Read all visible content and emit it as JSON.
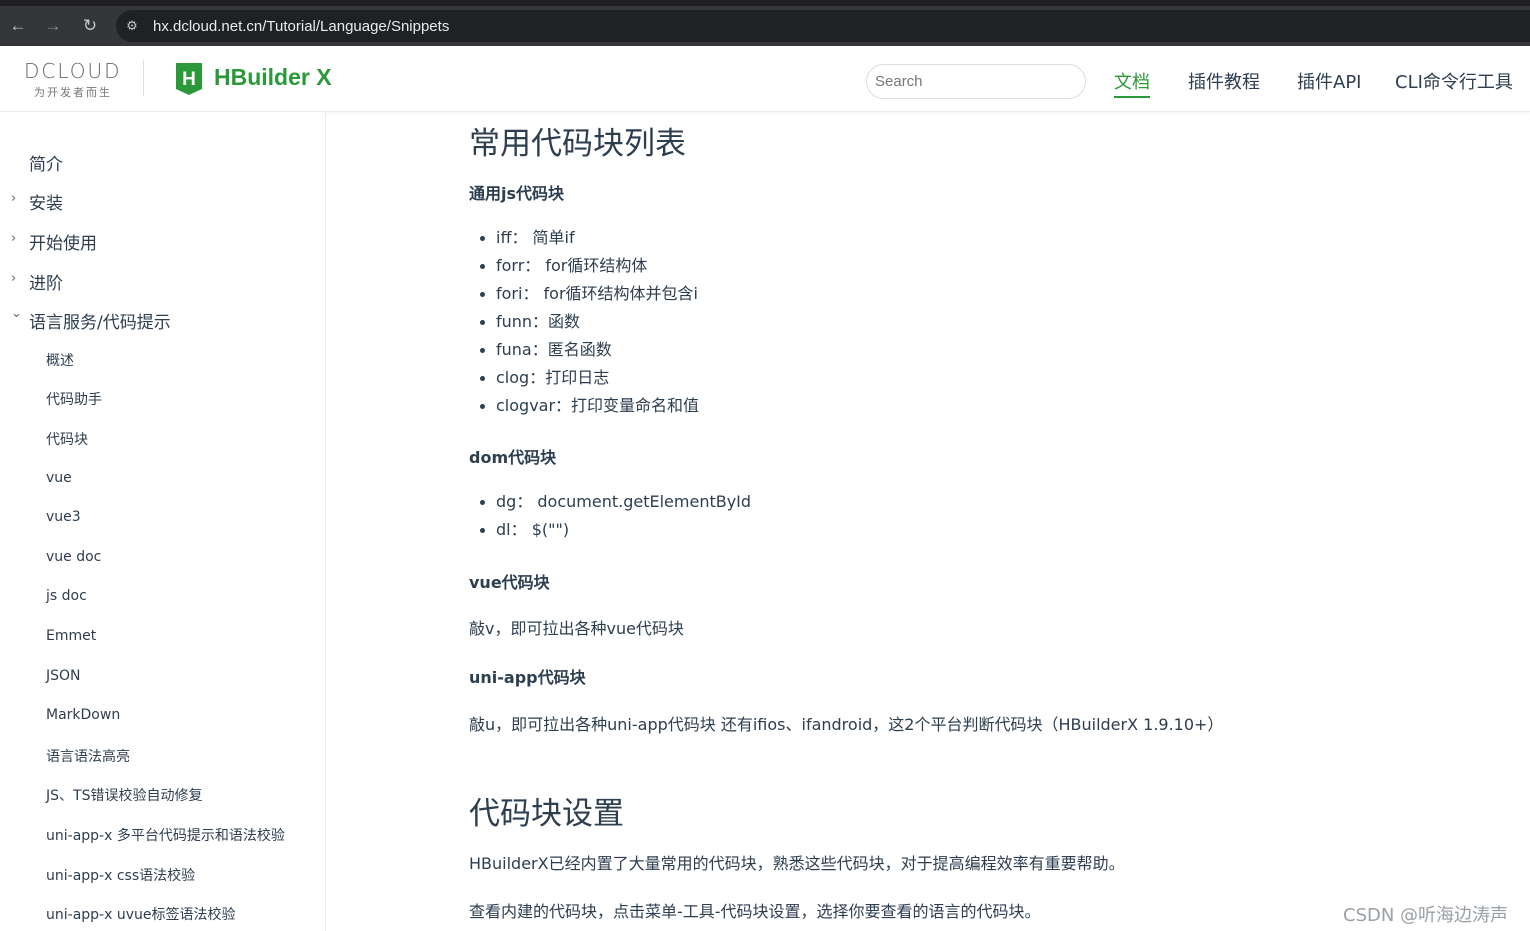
{
  "browser": {
    "back_icon": "←",
    "forward_icon": "→",
    "reload_icon": "↻",
    "site_info_icon": "⚙",
    "url": "hx.dcloud.net.cn/Tutorial/Language/Snippets"
  },
  "header": {
    "dcloud_logo": "DCLOUD",
    "dcloud_tagline": "为开发者而生",
    "product_logo_letter": "H",
    "product_title": "HBuilder X",
    "search_placeholder": "Search",
    "nav": [
      "文档",
      "插件教程",
      "插件API",
      "CLI命令行工具"
    ],
    "accent_color": "#2b9939"
  },
  "sidebar": {
    "top_items": [
      {
        "label": "简介",
        "arrow": ""
      },
      {
        "label": "安装",
        "arrow": "›"
      },
      {
        "label": "开始使用",
        "arrow": "›"
      },
      {
        "label": "进阶",
        "arrow": "›"
      },
      {
        "label": "语言服务/代码提示",
        "arrow": "⌄"
      }
    ],
    "sub_items": [
      "概述",
      "代码助手",
      "代码块",
      "vue",
      "vue3",
      "vue doc",
      "js doc",
      "Emmet",
      "JSON",
      "MarkDown",
      "语言语法高亮",
      "JS、TS错误校验自动修复",
      "uni-app-x 多平台代码提示和语法校验",
      "uni-app-x css语法校验",
      "uni-app-x uvue标签语法校验"
    ]
  },
  "content": {
    "h2_list": "常用代码块列表",
    "h3_js": "通用js代码块",
    "js_items": [
      "iff： 简单if",
      "forr： for循环结构体",
      "fori： for循环结构体并包含i",
      "funn：函数",
      "funa：匿名函数",
      "clog：打印日志",
      "clogvar：打印变量命名和值"
    ],
    "h3_dom": "dom代码块",
    "dom_items": [
      "dg： document.getElementById",
      "dl： $(\"\")"
    ],
    "h3_vue": "vue代码块",
    "p_vue": "敲v，即可拉出各种vue代码块",
    "h3_uniapp": "uni-app代码块",
    "p_uniapp": "敲u，即可拉出各种uni-app代码块 还有ifios、ifandroid，这2个平台判断代码块（HBuilderX 1.9.10+）",
    "h2_settings": "代码块设置",
    "p_settings_1": "HBuilderX已经内置了大量常用的代码块，熟悉这些代码块，对于提高编程效率有重要帮助。",
    "p_settings_2": "查看内建的代码块，点击菜单-工具-代码块设置，选择你要查看的语言的代码块。"
  },
  "watermark": "CSDN @听海边涛声"
}
